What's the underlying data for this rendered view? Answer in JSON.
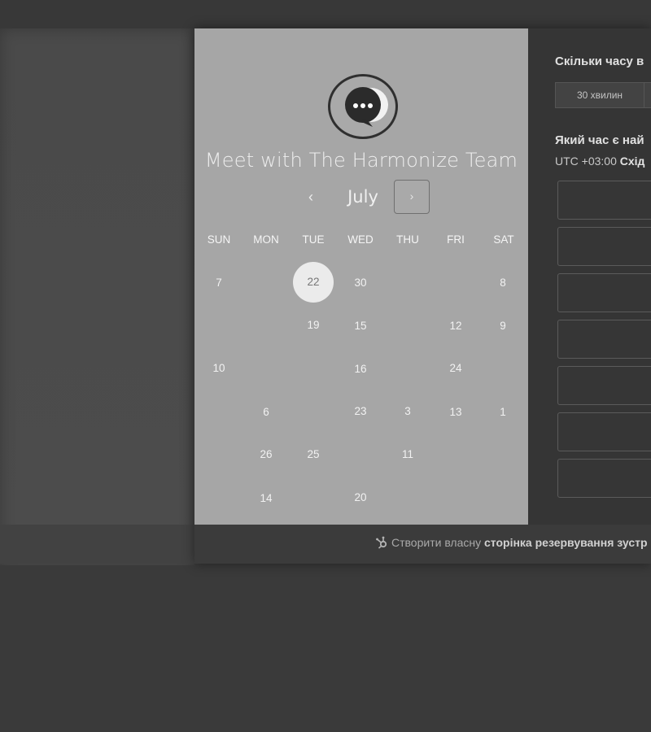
{
  "calendar": {
    "title": "Meet with The Harmonize Team",
    "month": "July",
    "prev_label": "‹",
    "next_label": "›",
    "weekdays": [
      "SUN",
      "MON",
      "TUE",
      "WED",
      "THU",
      "FRI",
      "SAT"
    ],
    "selected_day": "22",
    "days": [
      "7",
      "22",
      "30",
      "8",
      "19",
      "15",
      "12",
      "9",
      "10",
      "16",
      "24",
      "6",
      "23",
      "3",
      "13",
      "1",
      "26",
      "25",
      "11",
      "14",
      "20"
    ]
  },
  "booking": {
    "duration_question": "Скільки часу в",
    "durations": [
      "30 хвилин"
    ],
    "time_question": "Який час є най",
    "timezone_prefix": "UTC +03:00",
    "timezone_name": "Схід"
  },
  "footer": {
    "text": "Створити власну",
    "link": "сторінка резервування зустр"
  },
  "colors": {
    "calendar_bg": "#a6a6a6",
    "panel_bg": "#353535",
    "selected_day_bg": "#ebebeb"
  },
  "icons": {
    "avatar": "chat-bubble-icon",
    "footer": "hubspot-sprocket-icon"
  }
}
